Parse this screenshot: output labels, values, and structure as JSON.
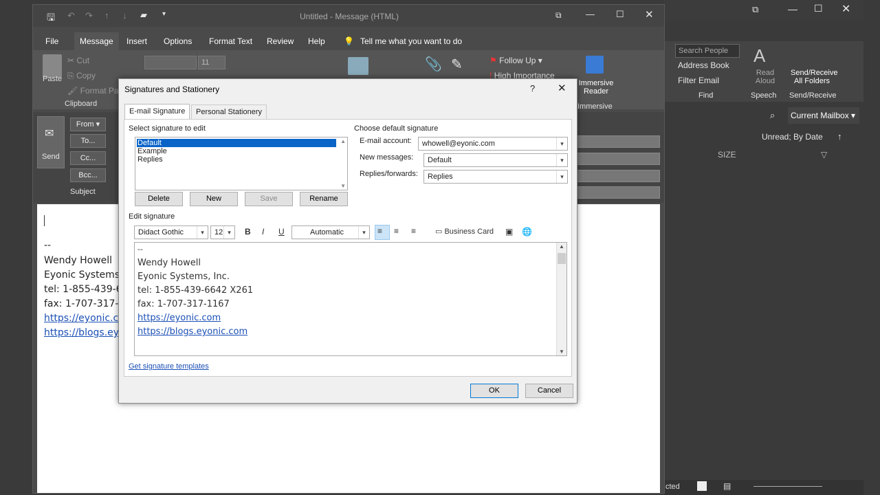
{
  "background_window": {
    "search_people_placeholder": "Search People",
    "address_book": "Address Book",
    "filter_email": "Filter Email",
    "find_group": "Find",
    "read_aloud": "Read Aloud",
    "speech_group": "Speech",
    "send_receive": "Send/Receive All Folders",
    "send_receive_group": "Send/Receive",
    "current_mailbox": "Current Mailbox",
    "sort_label": "Unread; By Date",
    "size_column": "SIZE",
    "status_text": "cted"
  },
  "message_window": {
    "title": "Untitled - Message (HTML)",
    "menu": [
      "File",
      "Message",
      "Insert",
      "Options",
      "Format Text",
      "Review",
      "Help"
    ],
    "tell_me": "Tell me what you want to do",
    "ribbon": {
      "paste": "Paste",
      "cut": "Cut",
      "copy": "Copy",
      "format_painter": "Format Pain",
      "clipboard": "Clipboard",
      "font_size": "11",
      "follow_up": "Follow Up",
      "high_importance": "High Importance",
      "immersive_reader": "Immersive Reader",
      "immersive_group": "Immersive"
    },
    "headers": {
      "send": "Send",
      "from": "From",
      "to": "To...",
      "cc": "Cc...",
      "bcc": "Bcc...",
      "subject": "Subject"
    },
    "body": {
      "separator": "--",
      "name": "Wendy Howell",
      "company": "Eyonic Systems, I",
      "tel": "tel: 1-855-439-66",
      "fax": "fax: 1-707-317-116",
      "link1": "https://eyonic.co",
      "link2": "https://blogs.eyo"
    }
  },
  "dialog": {
    "title": "Signatures and Stationery",
    "help": "?",
    "close": "✕",
    "tabs": [
      "E-mail Signature",
      "Personal Stationery"
    ],
    "select_label": "Select signature to edit",
    "signatures": [
      "Default",
      "Example",
      "Replies"
    ],
    "selected_signature": "Default",
    "buttons": {
      "delete": "Delete",
      "new": "New",
      "save": "Save",
      "rename": "Rename"
    },
    "choose_default": "Choose default signature",
    "email_account_label": "E-mail account:",
    "email_account_value": "whowell@eyonic.com",
    "new_messages_label": "New messages:",
    "new_messages_value": "Default",
    "replies_label": "Replies/forwards:",
    "replies_value": "Replies",
    "edit_signature_label": "Edit signature",
    "font_name": "Didact Gothic",
    "font_size": "12",
    "bold": "B",
    "italic": "I",
    "underline": "U",
    "color": "Automatic",
    "business_card": "Business Card",
    "signature_lines": [
      "--",
      "Wendy Howell",
      "Eyonic Systems, Inc.",
      "tel: 1-855-439-6642 X261",
      "fax: 1-707-317-1167"
    ],
    "signature_links": [
      "https://eyonic.com",
      "https://blogs.eyonic.com"
    ],
    "templates_link": "Get signature templates",
    "ok": "OK",
    "cancel": "Cancel"
  }
}
